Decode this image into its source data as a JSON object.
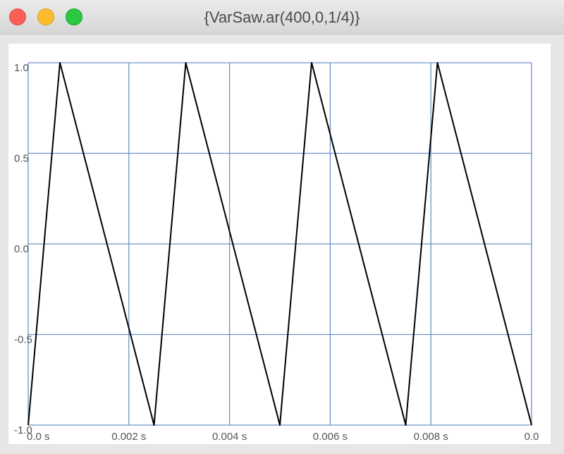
{
  "window": {
    "title": "{VarSaw.ar(400,0,1/4)}"
  },
  "chart_data": {
    "type": "line",
    "title": "",
    "xlabel": "",
    "ylabel": "",
    "xlim": [
      0,
      0.01
    ],
    "ylim": [
      -1,
      1
    ],
    "grid": true,
    "line_color": "#000000",
    "grid_color": "#6b93c6",
    "x_tick_labels": [
      "0.0 s",
      "0.002 s",
      "0.004 s",
      "0.006 s",
      "0.008 s",
      "0.0"
    ],
    "y_tick_labels": [
      "1.0",
      "0.5",
      "0.0",
      "-0.5",
      "-1.0"
    ],
    "series": [
      {
        "x": [
          0,
          0.00063,
          0.0025,
          0.00313,
          0.005,
          0.00563,
          0.0075,
          0.00813,
          0.01
        ],
        "values": [
          -1,
          1,
          -1,
          1,
          -1,
          1,
          -1,
          1,
          -1
        ]
      }
    ]
  }
}
